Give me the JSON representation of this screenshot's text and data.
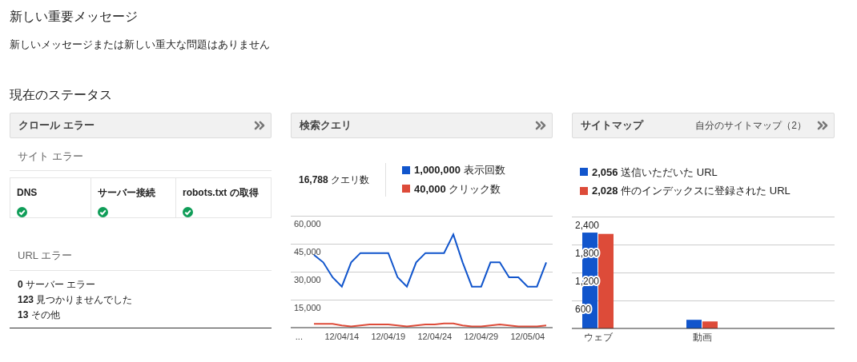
{
  "messages": {
    "title": "新しい重要メッセージ",
    "text": "新しいメッセージまたは新しい重大な問題はありません"
  },
  "status": {
    "title": "現在のステータス"
  },
  "crawl_errors": {
    "title": "クロール エラー",
    "site_errors_title": "サイト エラー",
    "site_errors": [
      {
        "label": "DNS",
        "ok": true
      },
      {
        "label": "サーバー接続",
        "ok": true
      },
      {
        "label": "robots.txt の取得",
        "ok": true
      }
    ],
    "url_errors_title": "URL エラー",
    "url_errors": [
      {
        "count": "0",
        "label": "サーバー エラー"
      },
      {
        "count": "123",
        "label": "見つかりませんでした"
      },
      {
        "count": "13",
        "label": "その他"
      }
    ]
  },
  "search_queries": {
    "title": "検索クエリ",
    "total": {
      "count": "16,788",
      "label": "クエリ数"
    },
    "legend": [
      {
        "count": "1,000,000",
        "label": "表示回数",
        "color": "#1155cc"
      },
      {
        "count": "40,000",
        "label": "クリック数",
        "color": "#dd4b39"
      }
    ],
    "chart_data": {
      "type": "line",
      "categories": [
        "...",
        null,
        null,
        null,
        null,
        "12/04/14",
        null,
        null,
        null,
        null,
        "12/04/19",
        null,
        null,
        null,
        null,
        "12/04/24",
        null,
        null,
        null,
        null,
        "12/04/29",
        null,
        null,
        null,
        null,
        "12/05/04",
        null,
        null
      ],
      "grid": true,
      "series": [
        {
          "color": "#1155cc",
          "values": [
            null,
            null,
            39000,
            35000,
            27000,
            22000,
            35000,
            40000,
            40000,
            40000,
            40000,
            27000,
            22000,
            35000,
            40000,
            40000,
            40000,
            50000,
            35000,
            22000,
            22000,
            35000,
            35000,
            27000,
            27000,
            22000,
            22000,
            35000
          ]
        },
        {
          "color": "#dd4b39",
          "values": [
            null,
            null,
            2000,
            2000,
            2000,
            1200,
            600,
            1200,
            1700,
            1700,
            1700,
            1200,
            600,
            1200,
            1700,
            1700,
            2200,
            2200,
            1200,
            600,
            600,
            1200,
            1700,
            1200,
            600,
            600,
            600,
            1200
          ]
        }
      ],
      "ylim": [
        0,
        60000
      ],
      "yticks": [
        {
          "value": 15000,
          "label": "15,000"
        },
        {
          "value": 30000,
          "label": "30,000"
        },
        {
          "value": 45000,
          "label": "45,000"
        },
        {
          "value": 60000,
          "label": "60,000"
        }
      ]
    }
  },
  "sitemaps": {
    "title": "サイトマップ",
    "link": "自分のサイトマップ（2）",
    "legend": [
      {
        "count": "2,056",
        "label": "送信いただいた URL",
        "color": "#1155cc"
      },
      {
        "count": "2,028",
        "label": "件のインデックスに登録された URL",
        "color": "#dd4b39"
      }
    ],
    "chart_data": {
      "type": "bar",
      "categories": [
        "ウェブ",
        "動画"
      ],
      "grid": true,
      "series": [
        {
          "color": "#1155cc",
          "values": [
            2056,
            185
          ]
        },
        {
          "color": "#dd4b39",
          "values": [
            2028,
            150
          ]
        }
      ],
      "ylim": [
        0,
        2400
      ],
      "yticks": [
        {
          "value": 600,
          "label": "600"
        },
        {
          "value": 1200,
          "label": "1,200"
        },
        {
          "value": 1800,
          "label": "1,800"
        },
        {
          "value": 2400,
          "label": "2,400"
        }
      ]
    }
  }
}
